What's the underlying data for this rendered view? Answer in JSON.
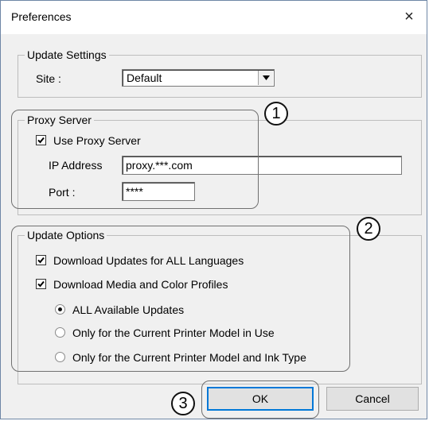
{
  "window": {
    "title": "Preferences",
    "close_glyph": "×"
  },
  "update_settings": {
    "legend": "Update Settings",
    "site_label": "Site :",
    "site_value": "Default"
  },
  "proxy_server": {
    "legend": "Proxy Server",
    "use_proxy_label": "Use Proxy Server",
    "use_proxy_checked": true,
    "ip_label": "IP Address",
    "ip_value": "proxy.***.com",
    "port_label": "Port :",
    "port_value": "****"
  },
  "update_options": {
    "legend": "Update Options",
    "download_all_languages_label": "Download Updates for ALL Languages",
    "download_all_languages_checked": true,
    "download_media_label": "Download Media and Color Profiles",
    "download_media_checked": true,
    "radios": [
      {
        "label": "ALL Available Updates",
        "selected": true
      },
      {
        "label": "Only for the Current Printer Model in Use",
        "selected": false
      },
      {
        "label": "Only for the Current Printer Model and Ink Type",
        "selected": false
      }
    ]
  },
  "callouts": [
    "1",
    "2",
    "3"
  ],
  "buttons": {
    "ok": "OK",
    "cancel": "Cancel"
  },
  "icons": {
    "close": "close-icon",
    "dropdown": "chevron-down-icon",
    "check": "check-icon"
  }
}
